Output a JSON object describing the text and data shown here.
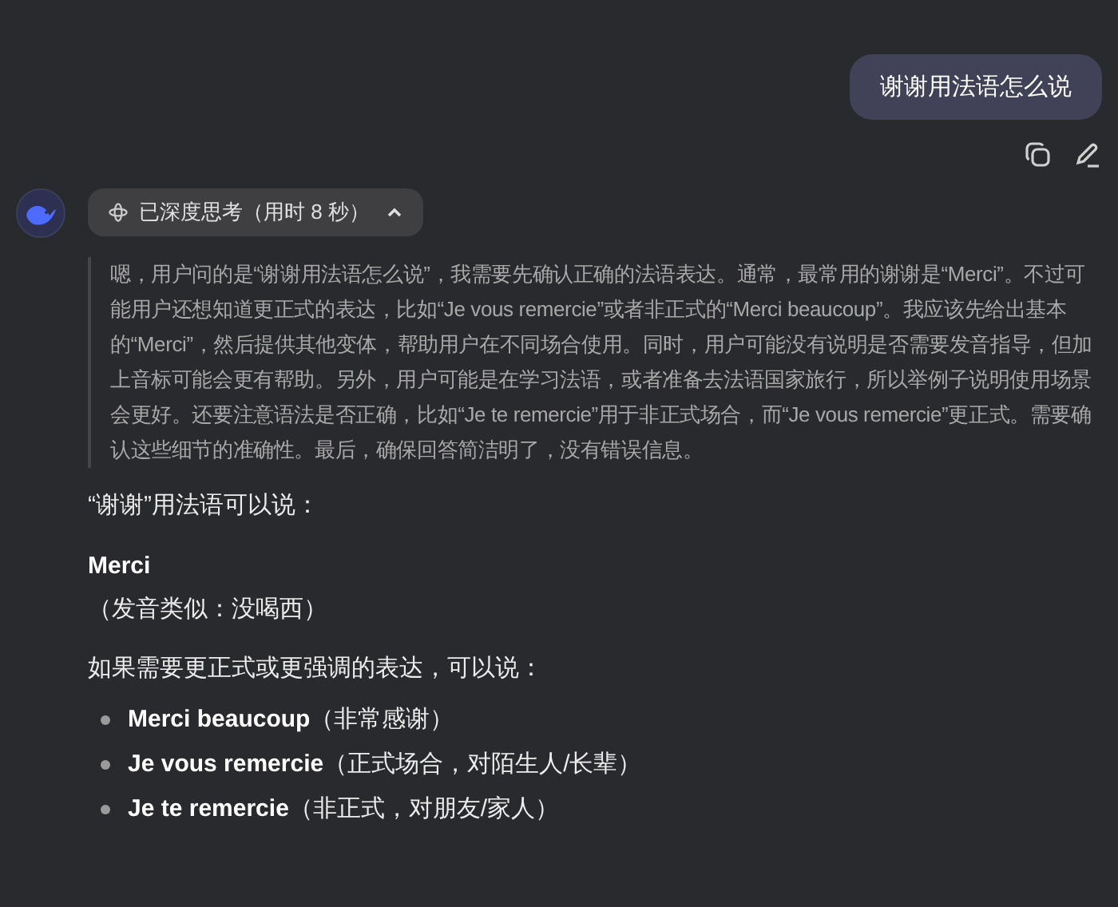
{
  "user_message": {
    "text": "谢谢用法语怎么说"
  },
  "message_actions": [
    {
      "kind": "copy"
    },
    {
      "kind": "edit"
    }
  ],
  "thinking": {
    "label": "已深度思考（用时 8 秒）",
    "expanded": true,
    "text": "嗯，用户问的是“谢谢用法语怎么说”，我需要先确认正确的法语表达。通常，最常用的谢谢是“Merci”。不过可能用户还想知道更正式的表达，比如“Je vous remercie”或者非正式的“Merci beaucoup”。我应该先给出基本的“Merci”，然后提供其他变体，帮助用户在不同场合使用。同时，用户可能没有说明是否需要发音指导，但加上音标可能会更有帮助。另外，用户可能是在学习法语，或者准备去法语国家旅行，所以举例子说明使用场景会更好。还要注意语法是否正确，比如“Je te remercie”用于非正式场合，而“Je vous remercie”更正式。需要确认这些细节的准确性。最后，确保回答简洁明了，没有错误信息。"
  },
  "answer": {
    "intro": "“谢谢”用法语可以说：",
    "heading": "Merci",
    "pronunciation": "（发音类似：没喝西）",
    "lead": "如果需要更正式或更强调的表达，可以说：",
    "bullets": [
      "**Merci beaucoup**（非常感谢）",
      "**Je vous remercie**（正式场合，对陌生人/长辈）",
      "**Je te remercie**（非正式，对朋友/家人）"
    ]
  }
}
